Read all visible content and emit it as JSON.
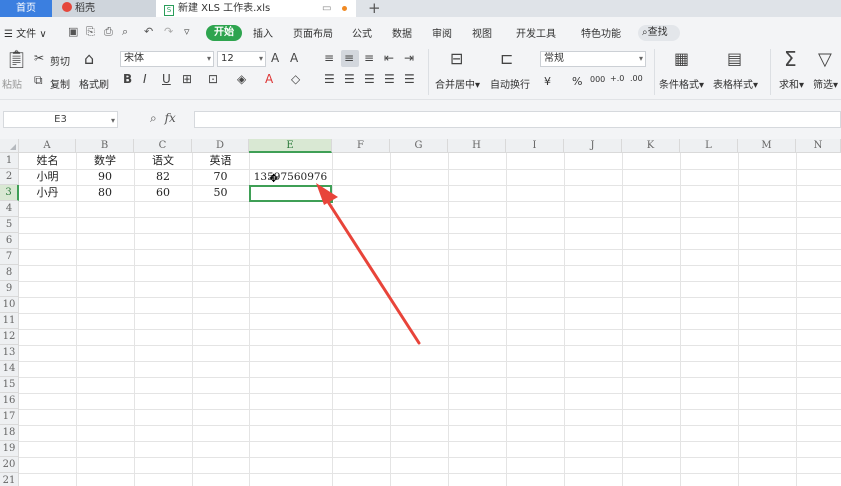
{
  "tabs": {
    "home": "首页",
    "daoke": "稻壳",
    "file": "新建 XLS 工作表.xls",
    "add": "+"
  },
  "menu": {
    "file": "文件",
    "start": "开始",
    "items": [
      "插入",
      "页面布局",
      "公式",
      "数据",
      "审阅",
      "视图",
      "开发工具",
      "特色功能"
    ],
    "search": "查找"
  },
  "ribbon": {
    "paste": "粘贴",
    "cut": "剪切",
    "copy": "复制",
    "format_painter": "格式刷",
    "font_name": "宋体",
    "font_size": "12",
    "merge": "合并居中",
    "wrap": "自动换行",
    "number_format": "常规",
    "currency": "¥",
    "percent": "%",
    "thousands": "000",
    "conditional": "条件格式",
    "table_style": "表格样式",
    "sum": "求和",
    "filter": "筛选"
  },
  "formula_bar": {
    "name_box": "E3",
    "fx": "fx",
    "value": ""
  },
  "columns": [
    "A",
    "B",
    "C",
    "D",
    "E",
    "F",
    "G",
    "H",
    "I",
    "J",
    "K",
    "L",
    "M",
    "N"
  ],
  "rows": [
    "1",
    "2",
    "3",
    "4",
    "5",
    "6",
    "7",
    "8",
    "9",
    "10",
    "11",
    "12",
    "13",
    "14",
    "15",
    "16",
    "17",
    "18",
    "19",
    "20",
    "21"
  ],
  "cells": {
    "r1": [
      "姓名",
      "数学",
      "语文",
      "英语"
    ],
    "r2": [
      "小明",
      "90",
      "82",
      "70",
      "13597560976"
    ],
    "r3": [
      "小丹",
      "80",
      "60",
      "50"
    ]
  },
  "selected": {
    "column": "E",
    "row": "3"
  },
  "colors": {
    "accent": "#2ea44f",
    "selection": "#3f9f56",
    "home_tab": "#3b7fe0",
    "annotation_arrow": "#e8443a"
  }
}
